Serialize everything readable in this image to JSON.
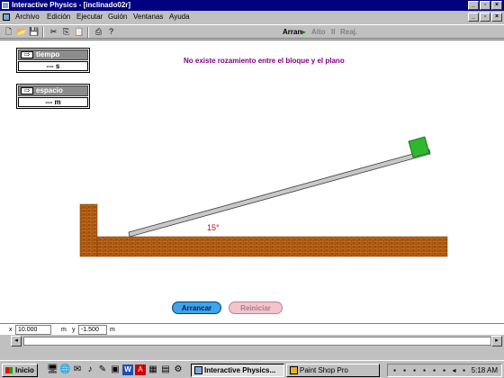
{
  "window": {
    "title": "Interactive Physics - [inclinado02r]"
  },
  "menu": [
    "Archivo",
    "Edición",
    "Ejecutar",
    "Guión",
    "Ventanas",
    "Ayuda"
  ],
  "toolbar": {
    "run_label": "Arran",
    "stop_label": "Alto",
    "reset_label": "Reaj."
  },
  "meters": [
    {
      "label": "tiempo",
      "value": "--- s"
    },
    {
      "label": "espacio",
      "value": "--- m"
    }
  ],
  "note": "No existe rozamiento entre el bloque y el plano",
  "angle_label": "15°",
  "buttons": {
    "run": "Arrancar",
    "reset": "Reiniciar"
  },
  "coords": {
    "x_label": "x",
    "x_value": "10.000",
    "x_unit": "m",
    "y_label": "y",
    "y_value": "-1.500",
    "y_unit": "m"
  },
  "taskbar": {
    "start": "Inicio",
    "tasks": [
      "Interactive Physics...",
      "Paint Shop Pro"
    ],
    "clock": "5:18 AM"
  },
  "colors": {
    "brick": "#c46a1a",
    "block": "#2db82d",
    "note": "#800080",
    "titlebar": "#000080"
  }
}
